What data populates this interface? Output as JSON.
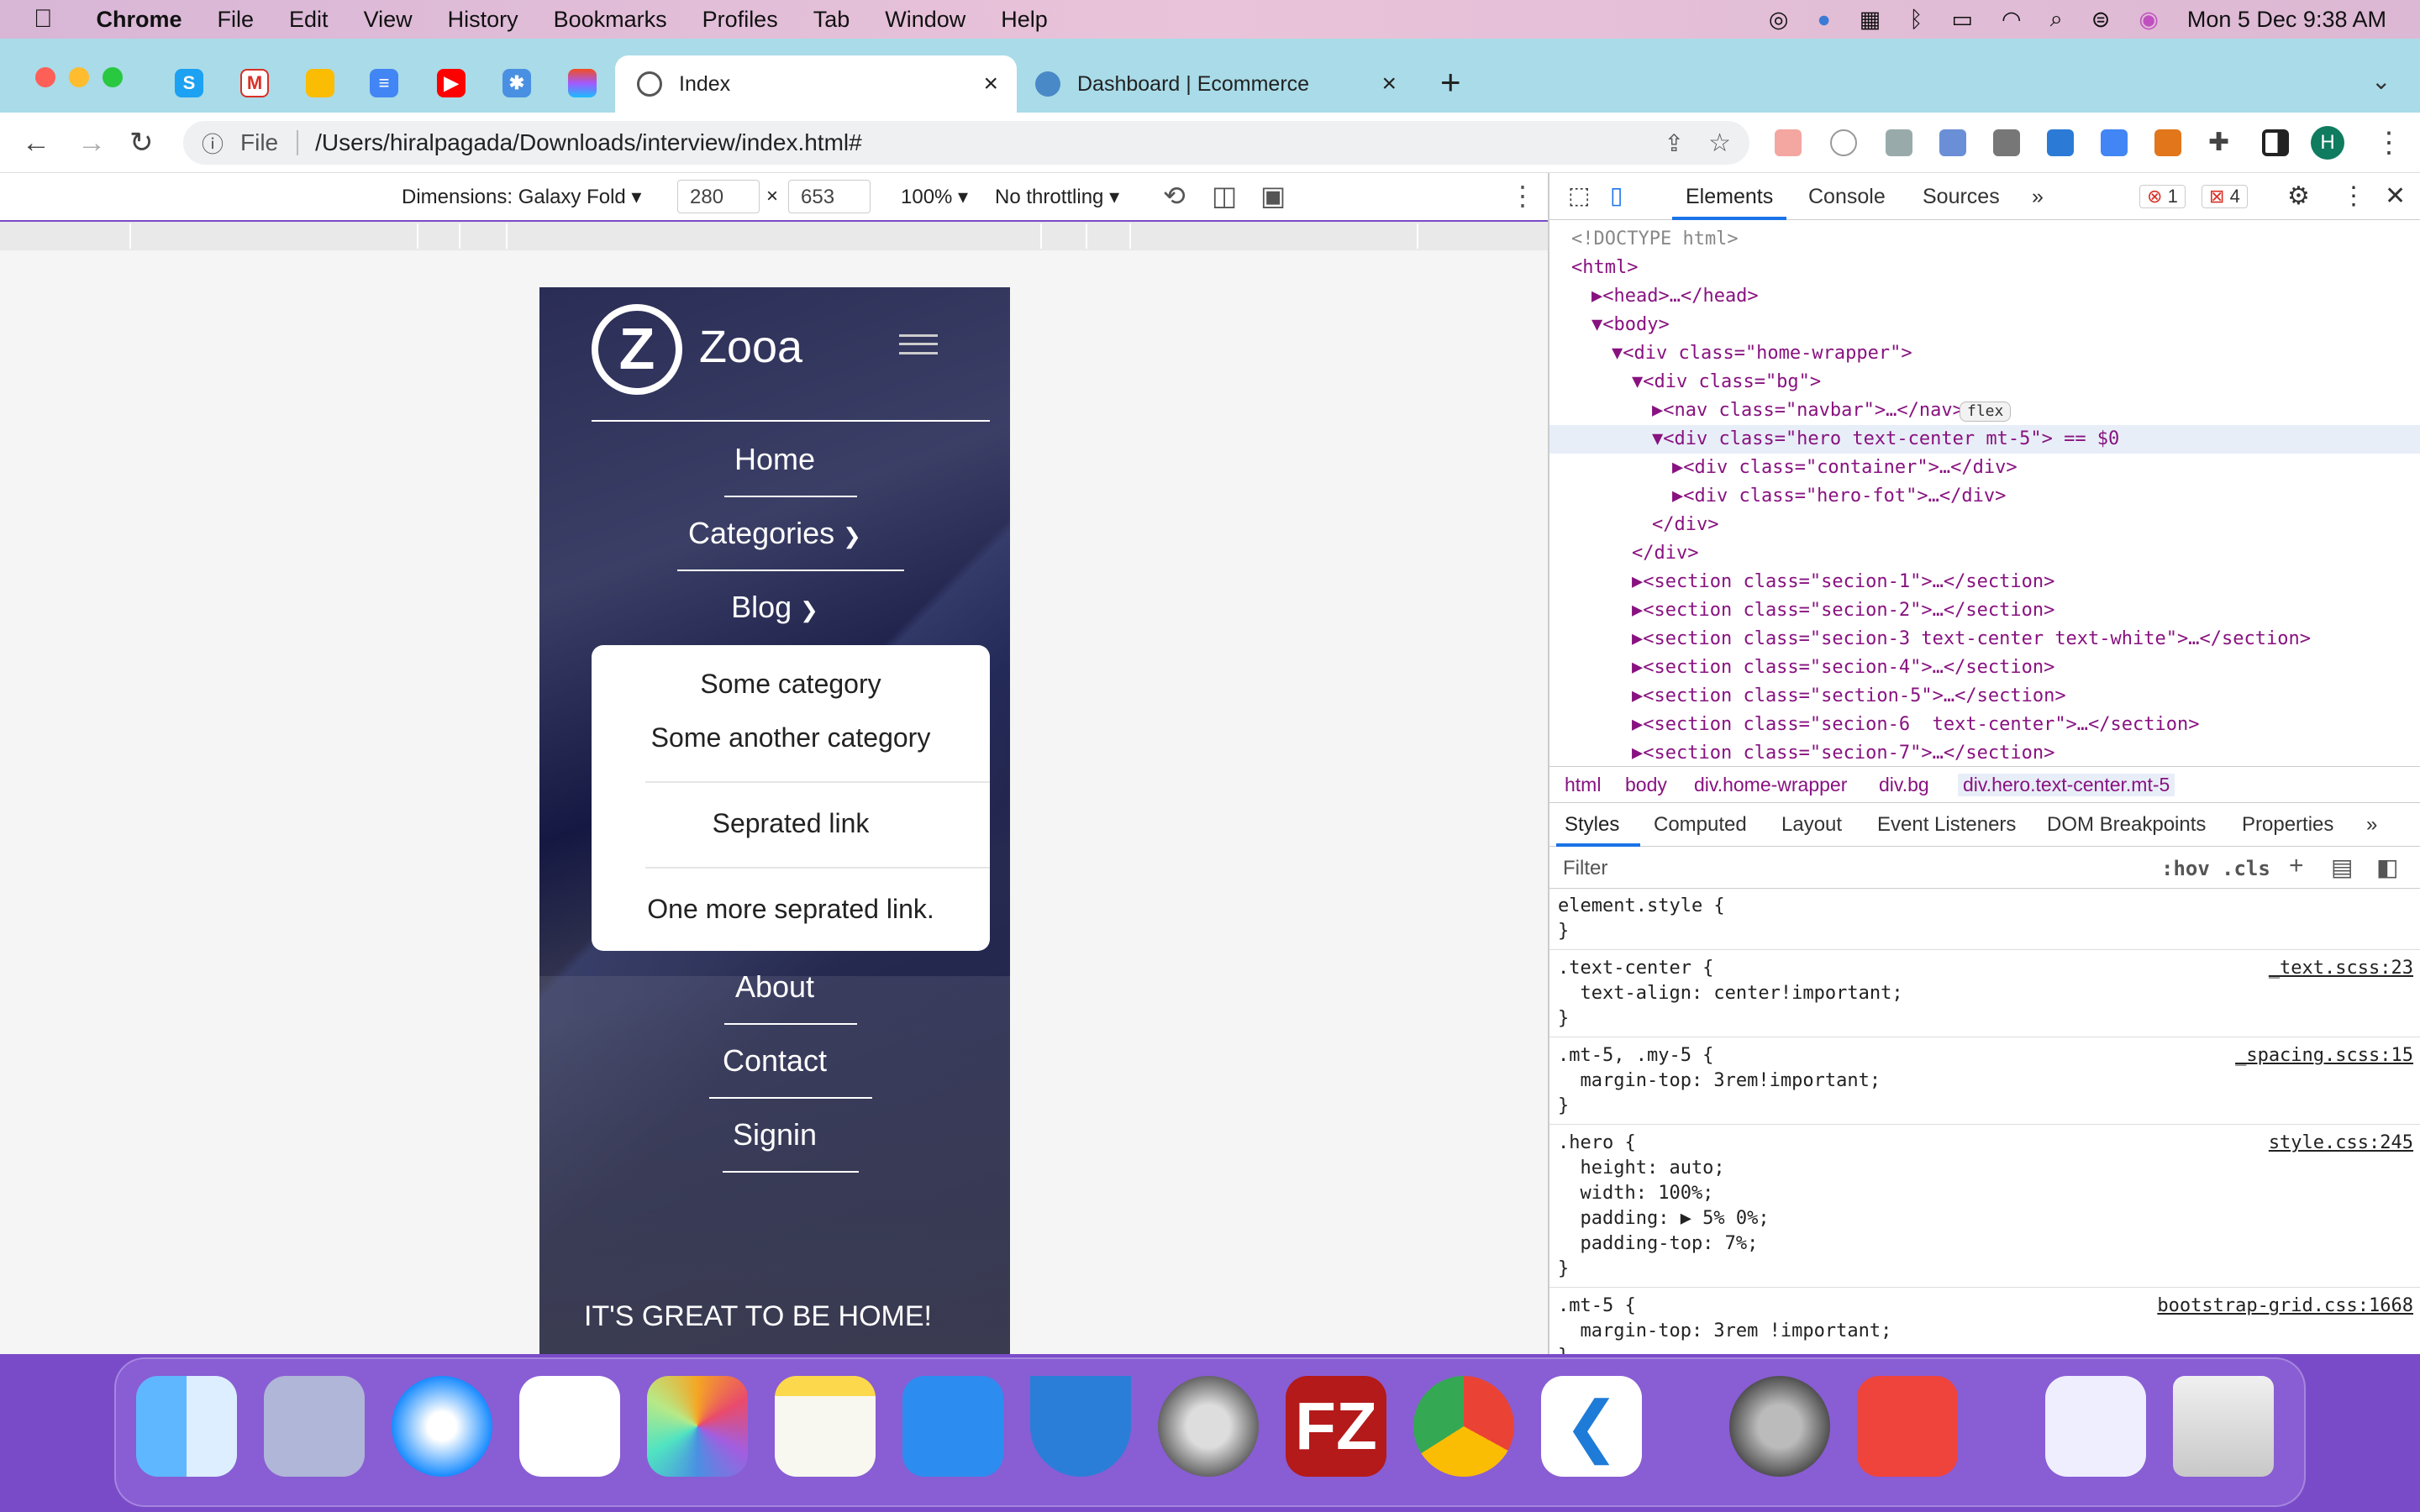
{
  "menubar": {
    "app": "Chrome",
    "items": [
      "File",
      "Edit",
      "View",
      "History",
      "Bookmarks",
      "Profiles",
      "Tab",
      "Window",
      "Help"
    ],
    "datetime": "Mon 5 Dec  9:38 AM"
  },
  "tabs": [
    {
      "title": "Index",
      "close": "×"
    },
    {
      "title": "Dashboard | Ecommerce",
      "close": "×"
    }
  ],
  "new_tab": "+",
  "address": {
    "scheme_label": "File",
    "url": "/Users/hiralpagada/Downloads/interview/index.html#"
  },
  "profile_initial": "H",
  "device_toolbar": {
    "dimensions": "Dimensions: Galaxy Fold ▾",
    "width": "280",
    "x": "×",
    "height": "653",
    "zoom": "100% ▾",
    "throttling": "No throttling ▾"
  },
  "site": {
    "brand": "Zooa",
    "logo_letter": "Z",
    "nav": [
      "Home",
      "Categories",
      "Blog"
    ],
    "dropdown": [
      "Some category",
      "Some another category",
      "Seprated link",
      "One more seprated link."
    ],
    "nav_after": [
      "About",
      "Contact",
      "Signin"
    ],
    "hero_text": "IT'S GREAT TO BE HOME!"
  },
  "devtools": {
    "tabs": [
      "Elements",
      "Console",
      "Sources",
      "»"
    ],
    "errors": "1",
    "warnings": "4",
    "dom": [
      {
        "indent": 0,
        "html": "<!DOCTYPE html>"
      },
      {
        "indent": 0,
        "html": "<html>"
      },
      {
        "indent": 1,
        "html": "▶<head>…</head>"
      },
      {
        "indent": 1,
        "html": "▼<body>"
      },
      {
        "indent": 2,
        "html": "▼<div class=\"home-wrapper\">"
      },
      {
        "indent": 3,
        "html": "▼<div class=\"bg\">"
      },
      {
        "indent": 4,
        "html": "▶<nav class=\"navbar\">…</nav>"
      },
      {
        "indent": 4,
        "html": "▼<div class=\"hero text-center mt-5\"> == $0"
      },
      {
        "indent": 5,
        "html": "▶<div class=\"container\">…</div>"
      },
      {
        "indent": 5,
        "html": "▶<div class=\"hero-fot\">…</div>"
      },
      {
        "indent": 4,
        "html": "</div>"
      },
      {
        "indent": 3,
        "html": "</div>"
      },
      {
        "indent": 3,
        "html": "▶<section class=\"secion-1\">…</section>"
      },
      {
        "indent": 3,
        "html": "▶<section class=\"secion-2\">…</section>"
      },
      {
        "indent": 3,
        "html": "▶<section class=\"secion-3 text-center text-white\">…</section>"
      },
      {
        "indent": 3,
        "html": "▶<section class=\"secion-4\">…</section>"
      },
      {
        "indent": 3,
        "html": "▶<section class=\"section-5\">…</section>"
      },
      {
        "indent": 3,
        "html": "▶<section class=\"secion-6  text-center\">…</section>"
      },
      {
        "indent": 3,
        "html": "▶<section class=\"secion-7\">…</section>"
      }
    ],
    "flex_badge": "flex",
    "breadcrumbs": [
      "html",
      "body",
      "div.home-wrapper",
      "div.bg",
      "div.hero.text-center.mt-5"
    ],
    "style_tabs": [
      "Styles",
      "Computed",
      "Layout",
      "Event Listeners",
      "DOM Breakpoints",
      "Properties",
      "»"
    ],
    "filter_placeholder": "Filter",
    "hov": ":hov",
    "cls": ".cls",
    "rules": [
      {
        "text": "element.style {\n}",
        "src": ""
      },
      {
        "text": ".text-center {\n  text-align: center!important;\n}",
        "src": "_text.scss:23"
      },
      {
        "text": ".mt-5, .my-5 {\n  margin-top: 3rem!important;\n}",
        "src": "_spacing.scss:15"
      },
      {
        "text": ".hero {\n  height: auto;\n  width: 100%;\n  padding: ▶ 5% 0%;\n  padding-top: 7%;\n}",
        "src": "style.css:245"
      },
      {
        "text": ".mt-5 {\n  margin-top: 3rem !important;\n}",
        "src": "bootstrap-grid.css:1668"
      }
    ]
  },
  "colors": {
    "accent": "#1a73e8",
    "tab_bar": "#a9dbe8",
    "dock": "#8a62d6"
  }
}
